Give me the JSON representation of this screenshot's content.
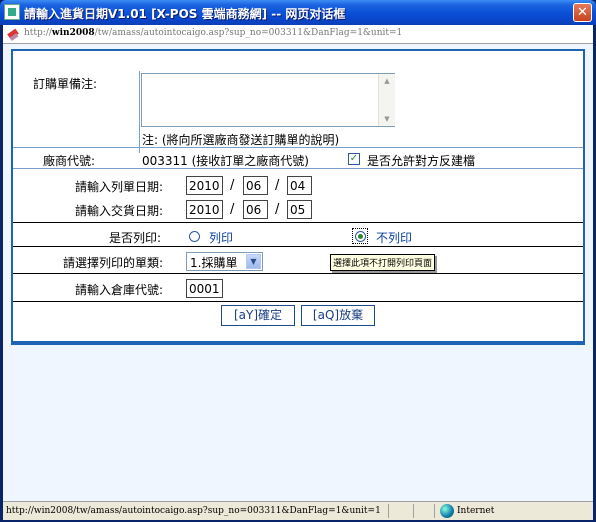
{
  "window": {
    "title": "請輸入進貨日期V1.01 [X-POS 雲端商務網] -- 网页对话框",
    "close_label": "✕"
  },
  "address": {
    "prefix": "http://",
    "host": "win2008",
    "path": "/tw/amass/autointocaigo.asp?sup_no=003311&DanFlag=1&unit=1"
  },
  "form": {
    "memo": {
      "label": "訂購單備注:",
      "value": "",
      "note": "注: (將向所選廠商發送訂購單的說明)"
    },
    "vendor": {
      "label": "廠商代號:",
      "code_text": "003311 (接收訂單之廠商代號)",
      "allow_label": "是否允許對方反建檔",
      "allow_checked": true
    },
    "list_date": {
      "label": "請輸入列單日期:",
      "year": "2010",
      "month": "06",
      "day": "04"
    },
    "delivery_date": {
      "label": "請輸入交貨日期:",
      "year": "2010",
      "month": "06",
      "day": "05"
    },
    "print": {
      "label": "是否列印:",
      "option_print": "列印",
      "option_noprint": "不列印",
      "selected": "noprint",
      "tooltip": "選擇此項不打開列印頁面"
    },
    "doc_type": {
      "label": "請選擇列印的單類:",
      "selected": "1.採購單"
    },
    "warehouse": {
      "label": "請輸入倉庫代號:",
      "value": "0001"
    },
    "buttons": {
      "confirm": "[aY]確定",
      "cancel": "[aQ]放棄"
    }
  },
  "statusbar": {
    "url": "http://win2008/tw/amass/autointocaigo.asp?sup_no=003311&DanFlag=1&unit=1",
    "zone": "Internet"
  }
}
